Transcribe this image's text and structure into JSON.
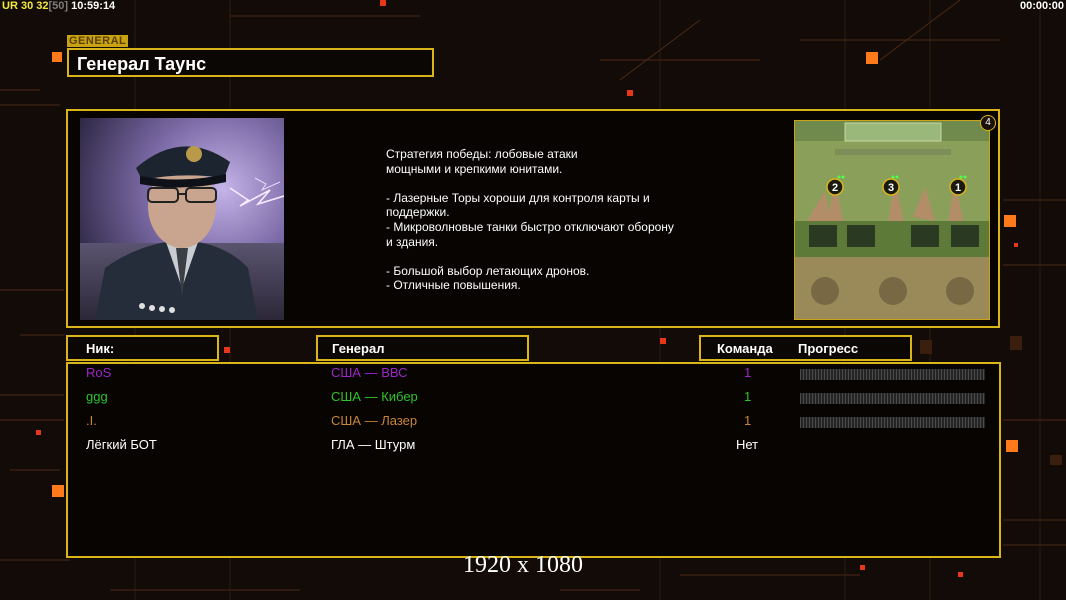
{
  "hud": {
    "ur_label": "UR",
    "n1": "30",
    "n2": "32",
    "n3": "[50]",
    "clock": "10:59:14",
    "timer": "00:00:00"
  },
  "header": {
    "tag": "GENERAL",
    "title": "Генерал Таунс"
  },
  "info": {
    "description": "Стратегия победы: лобовые атаки\nмощными и крепкими юнитами.\n\n- Лазерные Торы хороши для контроля карты и\n поддержки.\n- Микроволновые танки быстро отключают оборону\n и здания.\n\n- Большой выбор летающих дронов.\n- Отличные повышения.",
    "map_player_count": "4",
    "map_slots": [
      "2",
      "3",
      "1"
    ]
  },
  "columns": {
    "nick": "Ник:",
    "general": "Генерал",
    "team": "Команда",
    "progress": "Прогресс"
  },
  "players": [
    {
      "nick": "RoS",
      "general": "США — ВВС",
      "team": "1",
      "color": "#9b27c9",
      "progress": 0
    },
    {
      "nick": "ggg",
      "general": "США — Кибер",
      "team": "1",
      "color": "#2fc42a",
      "progress": 0
    },
    {
      "nick": ".I.",
      "general": "США — Лазер",
      "team": "1",
      "color": "#c9853a",
      "progress": 0
    },
    {
      "nick": "Лёгкий БОТ",
      "general": "ГЛА — Штурм",
      "team": "Нет",
      "color": "#ffffff",
      "progress": null
    }
  ],
  "footer": {
    "resolution": "1920 x 1080"
  },
  "colors": {
    "accent_gold": "#d9b51a",
    "hud_yellow": "#f2e93a",
    "orange_light": "#ff7a1a"
  }
}
